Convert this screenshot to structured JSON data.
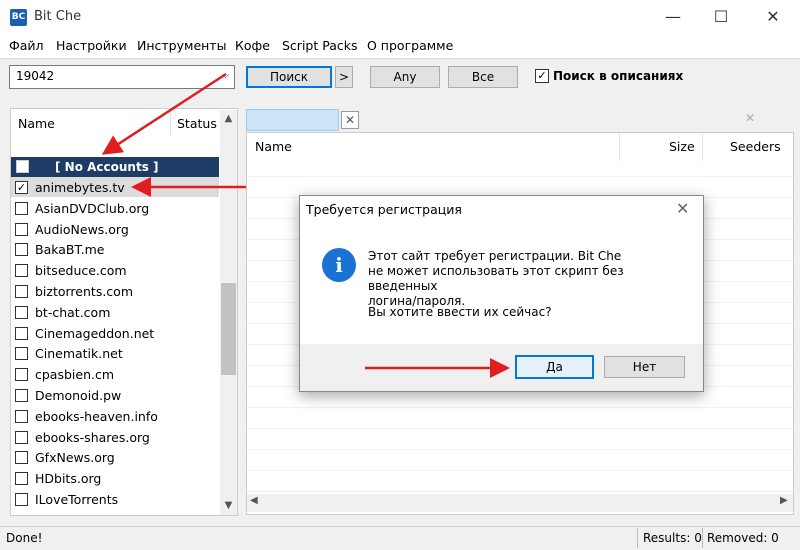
{
  "window": {
    "title": "Bit Che",
    "icon_text": "BC"
  },
  "menu": [
    "Файл",
    "Настройки",
    "Инструменты",
    "Кофе",
    "Script Packs",
    "О программе"
  ],
  "toolbar": {
    "search_value": "19042",
    "search_button": "Поиск",
    "more_button": ">",
    "any_button": "Any",
    "all_button": "Все",
    "desc_checkbox_label": "Поиск в описаниях"
  },
  "left_panel": {
    "col_name": "Name",
    "col_status": "Status",
    "header_item": "[ No Accounts ]",
    "items": [
      {
        "label": "animebytes.tv",
        "checked": true
      },
      {
        "label": "AsianDVDClub.org",
        "checked": false
      },
      {
        "label": "AudioNews.org",
        "checked": false
      },
      {
        "label": "BakaBT.me",
        "checked": false
      },
      {
        "label": "bitseduce.com",
        "checked": false
      },
      {
        "label": "biztorrents.com",
        "checked": false
      },
      {
        "label": "bt-chat.com",
        "checked": false
      },
      {
        "label": "Cinemageddon.net",
        "checked": false
      },
      {
        "label": "Cinematik.net",
        "checked": false
      },
      {
        "label": "cpasbien.cm",
        "checked": false
      },
      {
        "label": "Demonoid.pw",
        "checked": false
      },
      {
        "label": "ebooks-heaven.info",
        "checked": false
      },
      {
        "label": "ebooks-shares.org",
        "checked": false
      },
      {
        "label": "GfxNews.org",
        "checked": false
      },
      {
        "label": "HDbits.org",
        "checked": false
      },
      {
        "label": "ILoveTorrents",
        "checked": false
      }
    ]
  },
  "right_panel": {
    "col_name": "Name",
    "col_size": "Size",
    "col_seeders": "Seeders"
  },
  "dialog": {
    "title": "Требуется регистрация",
    "message_line1": "Этот сайт требует регистрации. Bit Che",
    "message_line2": "не может использовать этот скрипт без введенных",
    "message_line3": "логина/пароля.",
    "question": "Вы хотите ввести их сейчас?",
    "yes_button": "Да",
    "no_button": "Нет"
  },
  "status_bar": {
    "status": "Done!",
    "results": "Results: 0",
    "removed": "Removed: 0"
  },
  "colors": {
    "accent": "#0078d7",
    "selected_header": "#1e3c66",
    "arrow": "#e01e1e"
  }
}
